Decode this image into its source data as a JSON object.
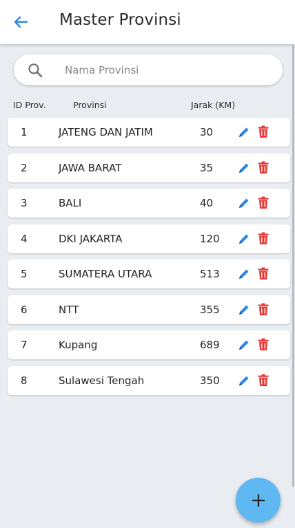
{
  "appbar": {
    "title": "Master Provinsi",
    "back_icon": "arrow-left-icon",
    "accent": "#2e86de"
  },
  "search": {
    "placeholder": "Nama Provinsi",
    "value": "",
    "icon": "search-icon"
  },
  "table": {
    "headers": {
      "id": "ID Prov.",
      "provinsi": "Provinsi",
      "jarak": "Jarak (KM)"
    },
    "rows": [
      {
        "id": "1",
        "provinsi": "JATENG DAN JATIM",
        "jarak": "30"
      },
      {
        "id": "2",
        "provinsi": "JAWA BARAT",
        "jarak": "35"
      },
      {
        "id": "3",
        "provinsi": "BALI",
        "jarak": "40"
      },
      {
        "id": "4",
        "provinsi": "DKI JAKARTA",
        "jarak": "120"
      },
      {
        "id": "5",
        "provinsi": "SUMATERA UTARA",
        "jarak": "513"
      },
      {
        "id": "6",
        "provinsi": "NTT",
        "jarak": "355"
      },
      {
        "id": "7",
        "provinsi": "Kupang",
        "jarak": "689"
      },
      {
        "id": "8",
        "provinsi": "Sulawesi Tengah",
        "jarak": "350"
      }
    ],
    "row_actions": {
      "edit_icon": "pencil-icon",
      "delete_icon": "trash-icon",
      "edit_color": "#2e86de",
      "delete_color": "#e53935"
    }
  },
  "fab": {
    "icon": "plus-icon",
    "color": "#5fb8f2"
  }
}
